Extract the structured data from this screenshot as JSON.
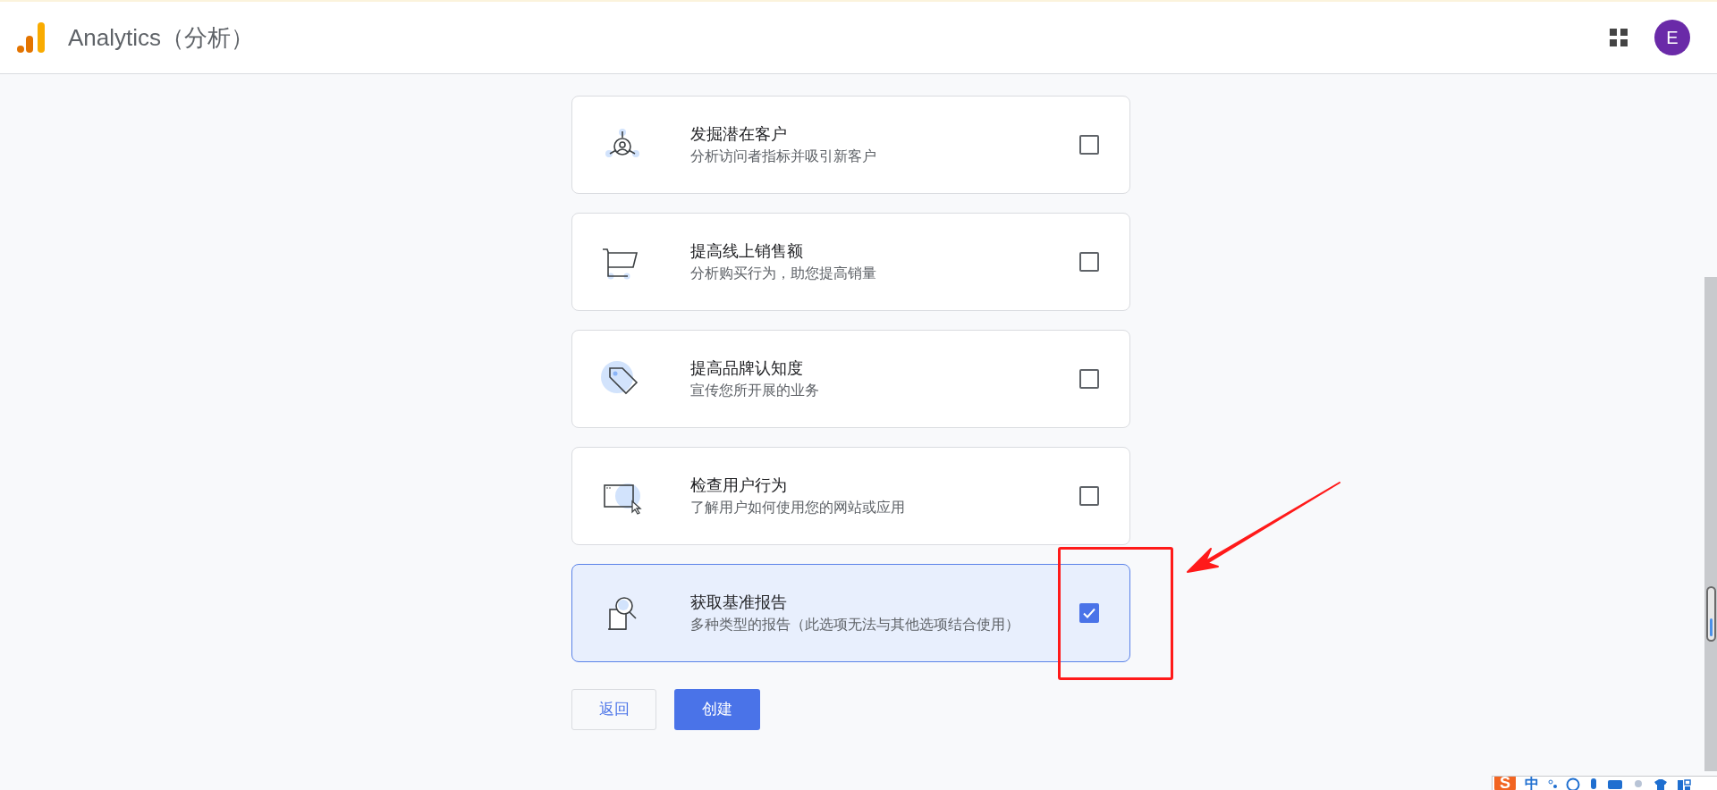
{
  "app": {
    "title": "Analytics（分析）",
    "avatar": "E"
  },
  "options": [
    {
      "title": "发掘潜在客户",
      "description": "分析访问者指标并吸引新客户",
      "checked": false
    },
    {
      "title": "提高线上销售额",
      "description": "分析购买行为，助您提高销量",
      "checked": false
    },
    {
      "title": "提高品牌认知度",
      "description": "宣传您所开展的业务",
      "checked": false
    },
    {
      "title": "检查用户行为",
      "description": "了解用户如何使用您的网站或应用",
      "checked": false
    },
    {
      "title": "获取基准报告",
      "description": "多种类型的报告（此选项无法与其他选项结合使用）",
      "checked": true
    }
  ],
  "buttons": {
    "back": "返回",
    "create": "创建"
  },
  "ime_toolbar": {
    "logo": "S",
    "mode": "中"
  }
}
